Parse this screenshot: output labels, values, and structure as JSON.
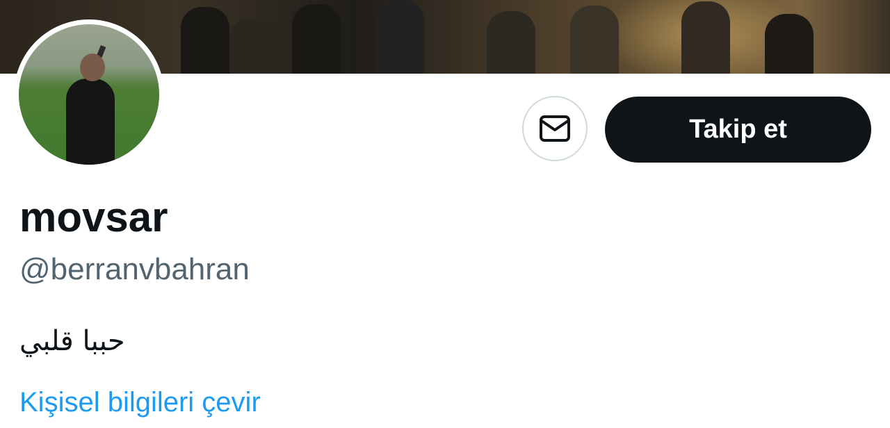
{
  "profile": {
    "display_name": "movsar",
    "handle": "@berranvbahran",
    "bio": "حببا قلبي",
    "translate_label": "Kişisel bilgileri çevir"
  },
  "actions": {
    "message_icon": "envelope-icon",
    "follow_label": "Takip et"
  },
  "colors": {
    "follow_bg": "#0f1419",
    "link": "#1d9bf0",
    "handle": "#536471"
  }
}
